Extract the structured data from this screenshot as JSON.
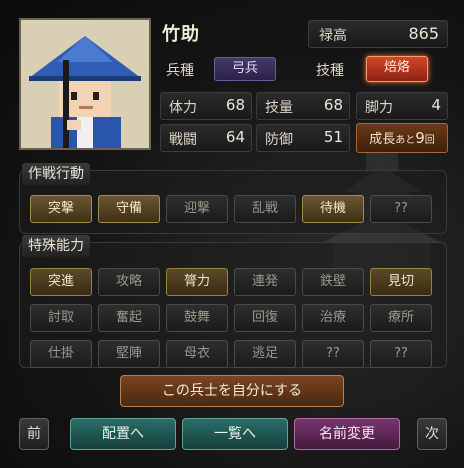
{
  "unit": {
    "name": "竹助",
    "salary_label": "禄高",
    "salary_value": "865",
    "troop_type_label": "兵種",
    "troop_type_value": "弓兵",
    "skill_type_label": "技種",
    "skill_type_value": "焙烙",
    "stats": {
      "hp_label": "体力",
      "hp_value": "68",
      "tech_label": "技量",
      "tech_value": "68",
      "leg_label": "脚力",
      "leg_value": "4",
      "battle_label": "戦闘",
      "battle_value": "64",
      "defense_label": "防御",
      "defense_value": "51"
    },
    "growth_text": "成長",
    "growth_small": "あと",
    "growth_value": "9",
    "growth_unit": "回"
  },
  "tactics": {
    "title": "作戦行動",
    "items": [
      {
        "label": "突撃",
        "active": true
      },
      {
        "label": "守備",
        "active": true
      },
      {
        "label": "迎撃",
        "active": false
      },
      {
        "label": "乱戦",
        "active": false
      },
      {
        "label": "待機",
        "active": true
      },
      {
        "label": "??",
        "active": false
      }
    ]
  },
  "abilities": {
    "title": "特殊能力",
    "items": [
      {
        "label": "突進",
        "active": true
      },
      {
        "label": "攻略",
        "active": false
      },
      {
        "label": "膂力",
        "active": true
      },
      {
        "label": "連発",
        "active": false
      },
      {
        "label": "鉄壁",
        "active": false
      },
      {
        "label": "見切",
        "active": true
      },
      {
        "label": "討取",
        "active": false
      },
      {
        "label": "奮起",
        "active": false
      },
      {
        "label": "鼓舞",
        "active": false
      },
      {
        "label": "回復",
        "active": false
      },
      {
        "label": "治療",
        "active": false
      },
      {
        "label": "療所",
        "active": false
      },
      {
        "label": "仕掛",
        "active": false
      },
      {
        "label": "堅陣",
        "active": false
      },
      {
        "label": "母衣",
        "active": false
      },
      {
        "label": "逃足",
        "active": false
      },
      {
        "label": "??",
        "active": false
      },
      {
        "label": "??",
        "active": false
      }
    ]
  },
  "actions": {
    "make_own": "この兵士を自分にする",
    "prev": "前",
    "deploy": "配置へ",
    "list": "一覧へ",
    "rename": "名前変更",
    "next": "次"
  },
  "colors": {
    "active_gold": "#6a5630",
    "skill_red": "#b3321f",
    "troop_purple": "#3a2f5a",
    "teal_button": "#1f5a55",
    "rename_purple": "#6a2a5e",
    "brown_button": "#6b3a18"
  }
}
